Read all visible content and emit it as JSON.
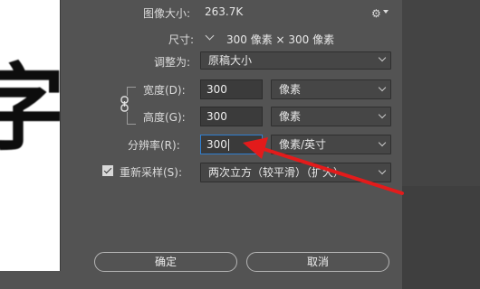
{
  "preview": {
    "glyph": "字"
  },
  "header": {
    "image_size_label": "图像大小:",
    "image_size_value": "263.7K"
  },
  "dimensions": {
    "label": "尺寸:",
    "value": "300 像素 × 300 像素"
  },
  "resize": {
    "label": "调整为:",
    "selected": "原稿大小"
  },
  "width": {
    "label": "宽度(D):",
    "value": "300",
    "unit": "像素"
  },
  "height": {
    "label": "高度(G):",
    "value": "300",
    "unit": "像素"
  },
  "resolution": {
    "label": "分辨率(R):",
    "value": "300",
    "unit": "像素/英寸"
  },
  "resample": {
    "label": "重新采样(S):",
    "checked": true,
    "method": "两次立方（较平滑）（扩大）"
  },
  "buttons": {
    "ok": "确定",
    "cancel": "取消"
  },
  "colors": {
    "arrow": "#e31b1b",
    "focus": "#2f7fd1"
  }
}
